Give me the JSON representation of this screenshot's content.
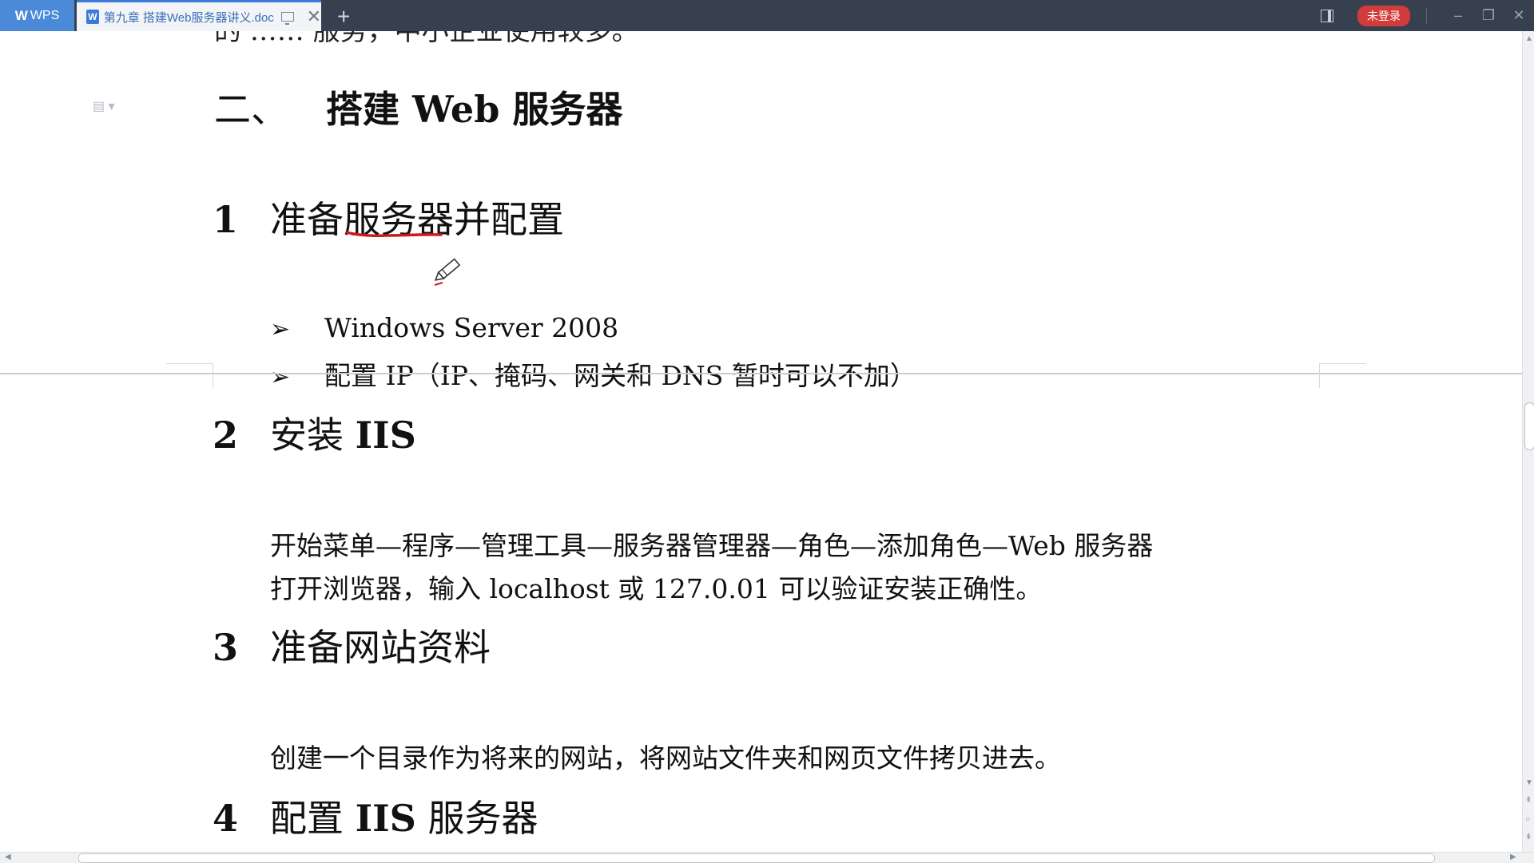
{
  "titlebar": {
    "app_label": "WPS",
    "doc_tab_title": "第九章 搭建Web服务器讲义.doc",
    "doc_icon": "W",
    "new_tab": "+",
    "close_tab": "✕",
    "login_label": "未登录",
    "minimize": "–",
    "restore": "❐",
    "close": "✕"
  },
  "document": {
    "cut_text": "的 …… 服务，中小企业使用较多。",
    "side_widget": "▤ ▾",
    "section_number": "二、",
    "section_title": "搭建 Web 服务器",
    "bullet_mark": "➢",
    "steps": [
      {
        "number": "1",
        "title": "准备服务器并配置",
        "bullets": [
          "Windows Server 2008",
          "配置 IP（IP、掩码、网关和 DNS 暂时可以不加）"
        ]
      },
      {
        "number": "2",
        "title_prefix": "安装 ",
        "title_bold": "IIS",
        "lines": [
          "开始菜单—程序—管理工具—服务器管理器—角色—添加角色—Web 服务器",
          "打开浏览器，输入 localhost 或 127.0.01 可以验证安装正确性。"
        ]
      },
      {
        "number": "3",
        "title": "准备网站资料",
        "lines": [
          "创建一个目录作为将来的网站，将网站文件夹和网页文件拷贝进去。"
        ]
      },
      {
        "number": "4",
        "title_prefix": "配置 ",
        "title_bold": "IIS",
        "title_suffix": " 服务器"
      }
    ]
  },
  "colors": {
    "titlebar_bg": "#37404e",
    "wps_blue": "#4a8ad8",
    "login_red": "#d23b3b",
    "annotation_red": "#cc1a1a"
  }
}
